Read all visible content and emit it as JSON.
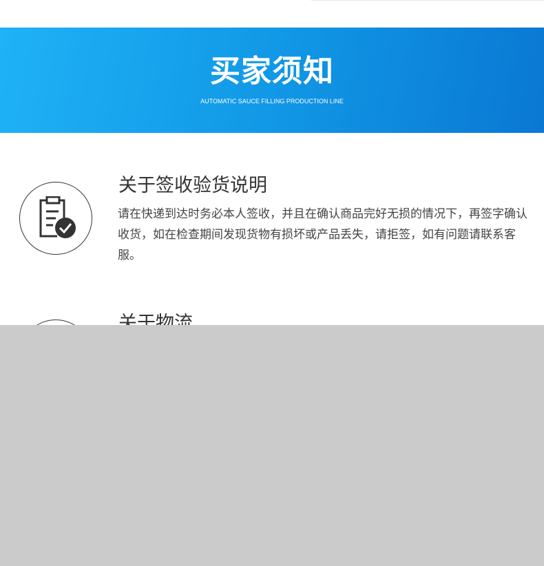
{
  "banner": {
    "title": "买家须知",
    "subtitle": "AUTOMATIC SAUCE FILLING PRODUCTION LINE"
  },
  "sections": [
    {
      "title": "关于签收验货说明",
      "body": "请在快递到达时务必本人签收，并且在确认商品完好无损的情况下，再签字确认收货，如在检查期间发现货物有损坏或产品丢失，请拒签，如有问题请联系客服。",
      "icon": "clipboard-check-icon"
    },
    {
      "title": "关于物流",
      "icon": "logistics-icon"
    }
  ],
  "colors": {
    "banner_start": "#1fb2f6",
    "banner_end": "#0a78d3",
    "overlay": "#cbcbcb"
  }
}
